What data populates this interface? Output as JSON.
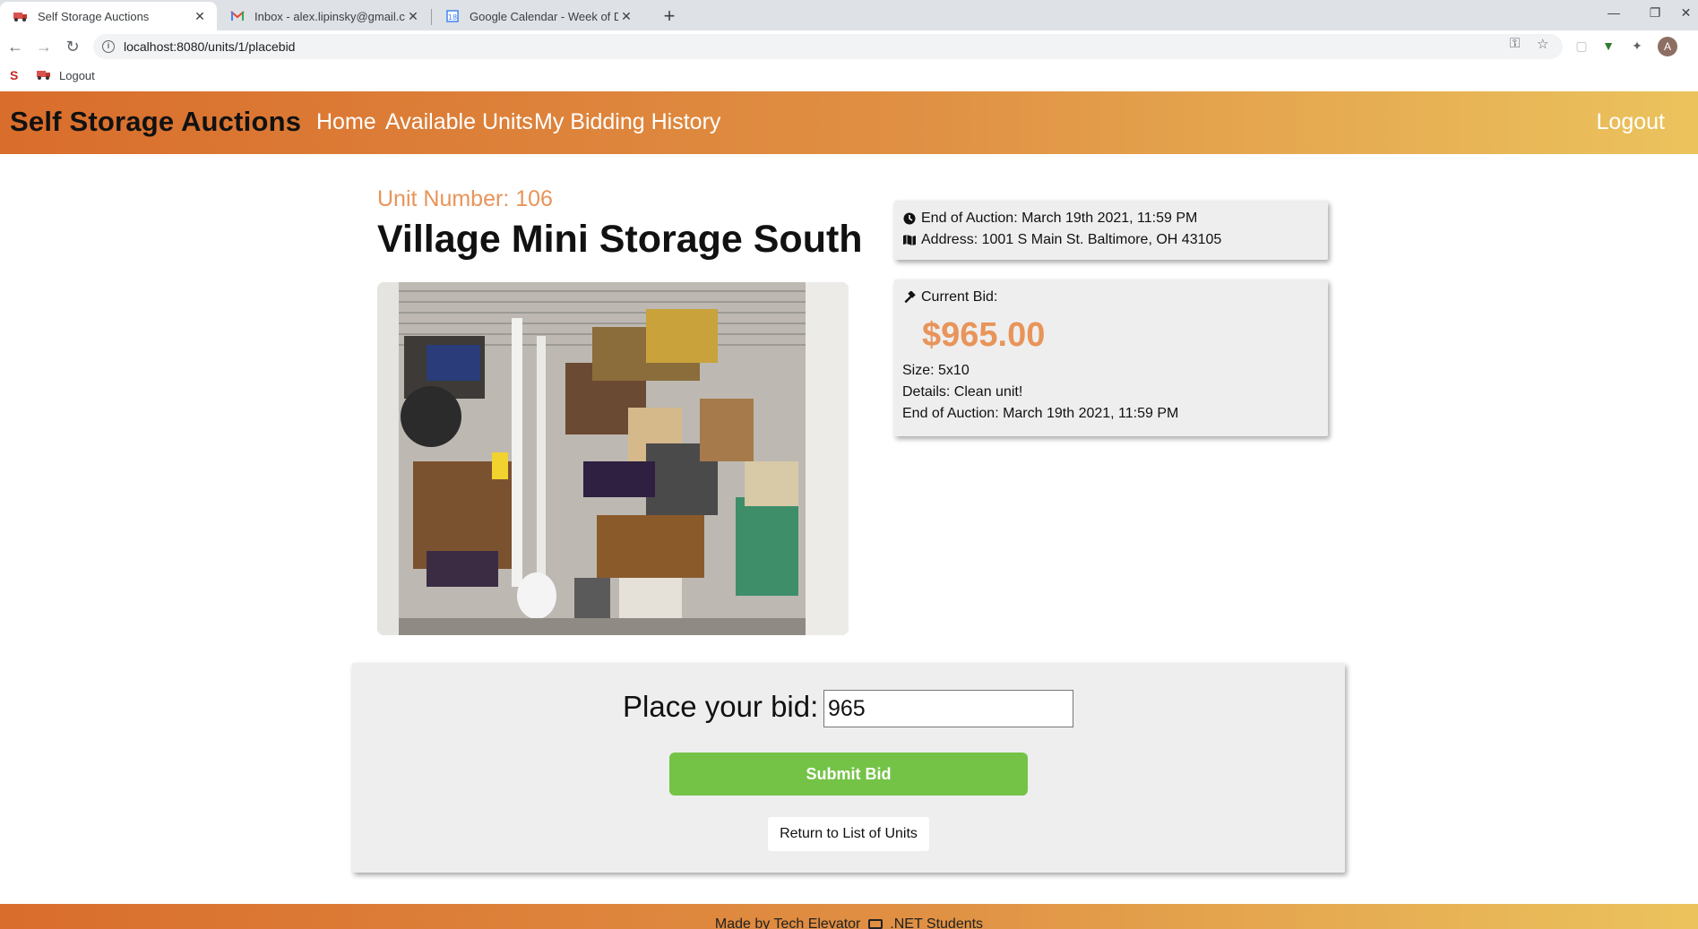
{
  "browser": {
    "tabs": [
      {
        "title": "Self Storage Auctions",
        "icon": "truck-icon",
        "active": true
      },
      {
        "title": "Inbox - alex.lipinsky@gmail.com",
        "icon": "gmail-icon",
        "active": false
      },
      {
        "title": "Google Calendar - Week of Dece",
        "icon": "calendar-icon",
        "active": false
      }
    ],
    "url": "localhost:8080/units/1/placebid",
    "bookmarks": [
      {
        "label": "",
        "icon": "s-logo-icon"
      },
      {
        "label": "Logout",
        "icon": "truck-icon"
      }
    ],
    "profile_initial": "A"
  },
  "header": {
    "brand": "Self Storage Auctions",
    "nav": [
      "Home",
      "Available Units",
      "My Bidding History"
    ],
    "logout": "Logout"
  },
  "unit": {
    "number_label": "Unit Number: 106",
    "name": "Village Mini Storage South",
    "photo_alt": "storage unit contents"
  },
  "summary_card": {
    "end_of_auction": "End of Auction: March 19th 2021, 11:59 PM",
    "address": "Address: 1001 S Main St. Baltimore, OH 43105"
  },
  "bid_card": {
    "current_bid_label": "Current Bid:",
    "current_bid": "$965.00",
    "size": "Size: 5x10",
    "details": "Details: Clean unit!",
    "end_of_auction": "End of Auction: March 19th 2021, 11:59 PM"
  },
  "bid_form": {
    "label": "Place your bid:",
    "value": "965",
    "submit": "Submit Bid",
    "return": "Return to List of Units"
  },
  "footer": {
    "left": "Made by Tech Elevator",
    "right": ".NET Students"
  },
  "colors": {
    "accent_orange": "#e8945a",
    "header_gradient_start": "#d96d2c",
    "header_gradient_end": "#ebc35d",
    "submit_green": "#74c347",
    "card_bg": "#eeeeee"
  }
}
